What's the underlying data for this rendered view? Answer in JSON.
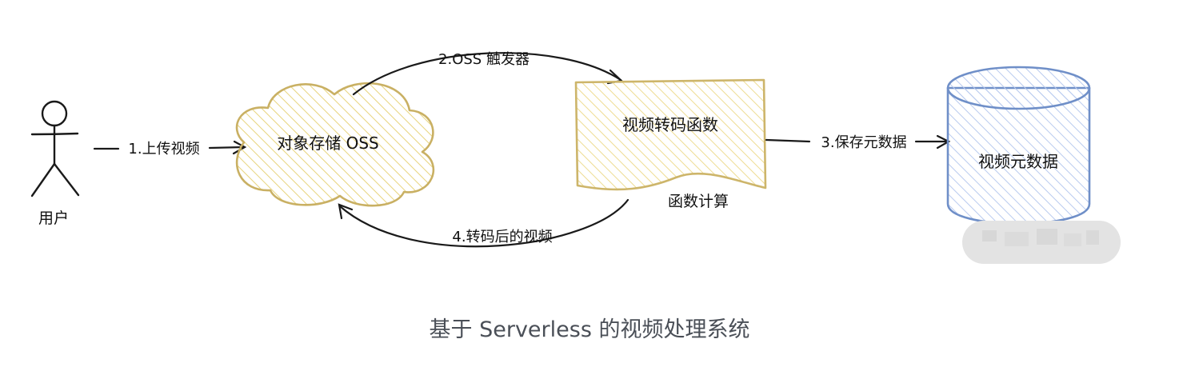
{
  "diagram": {
    "user_label": "用户",
    "oss_label": "对象存储 OSS",
    "fc_label": "视频转码函数",
    "fc_sub_label": "函数计算",
    "db_label": "视频元数据",
    "edges": {
      "e1": "1.上传视频",
      "e2": "2.OSS 触发器",
      "e3": "3.保存元数据",
      "e4": "4.转码后的视频"
    },
    "colors": {
      "cloud_stroke": "#c9b063",
      "cloud_fill": "#f7e7a3",
      "doc_stroke": "#cdb56a",
      "doc_fill": "#f6e9b4",
      "db_stroke": "#6f8fc8",
      "db_fill": "#c9d7f2",
      "line": "#1a1a1a"
    }
  },
  "caption": "基于 Serverless 的视频处理系统"
}
